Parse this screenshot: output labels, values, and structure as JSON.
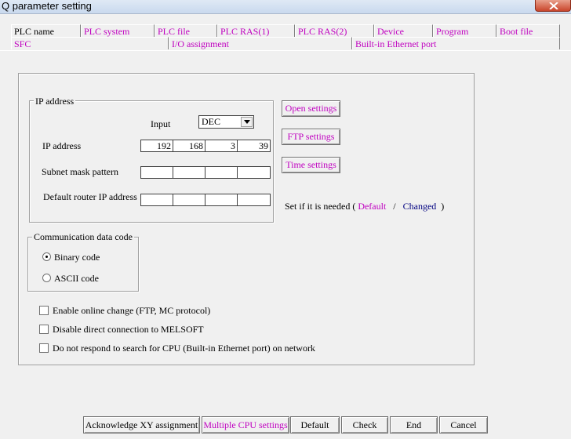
{
  "window": {
    "title": "Q parameter setting"
  },
  "tabs": {
    "row1": [
      {
        "label": "PLC name",
        "active": true
      },
      {
        "label": "PLC system",
        "active": false
      },
      {
        "label": "PLC file",
        "active": false
      },
      {
        "label": "PLC RAS(1)",
        "active": false
      },
      {
        "label": "PLC RAS(2)",
        "active": false
      },
      {
        "label": "Device",
        "active": false
      },
      {
        "label": "Program",
        "active": false
      },
      {
        "label": "Boot file",
        "active": false
      }
    ],
    "row2": [
      {
        "label": "SFC",
        "active": false
      },
      {
        "label": "I/O assignment",
        "active": false
      },
      {
        "label": "Built-in Ethernet port",
        "active": false
      }
    ]
  },
  "ip_section": {
    "group_label": "IP address",
    "input_label": "Input",
    "input_mode": "DEC",
    "ip_address_label": "IP address",
    "ip_address": [
      "192",
      "168",
      "3",
      "39"
    ],
    "subnet_label": "Subnet mask pattern",
    "subnet": [
      "",
      "",
      "",
      ""
    ],
    "router_label": "Default router IP address",
    "router": [
      "",
      "",
      "",
      ""
    ]
  },
  "settings_buttons": {
    "open": "Open settings",
    "ftp": "FTP settings",
    "time": "Time settings"
  },
  "legend": {
    "prefix": "Set if it is needed (",
    "default": "Default",
    "separator": "/",
    "changed": "Changed",
    "suffix": ")"
  },
  "comm_code": {
    "group_label": "Communication data code",
    "options": [
      {
        "label": "Binary code",
        "selected": true
      },
      {
        "label": "ASCII code",
        "selected": false
      }
    ]
  },
  "checkboxes": [
    {
      "label": "Enable online change (FTP, MC protocol)",
      "checked": false
    },
    {
      "label": "Disable direct connection to MELSOFT",
      "checked": false
    },
    {
      "label": "Do not respond to search for CPU (Built-in Ethernet port) on network",
      "checked": false
    }
  ],
  "footer_buttons": {
    "acknowledge": "Acknowledge XY assignment",
    "multiple_cpu": "Multiple CPU settings",
    "default": "Default",
    "check": "Check",
    "end": "End",
    "cancel": "Cancel"
  },
  "colors": {
    "tab_text": "#c000c0",
    "default_legend": "#c000c0",
    "changed_legend": "#000080"
  }
}
